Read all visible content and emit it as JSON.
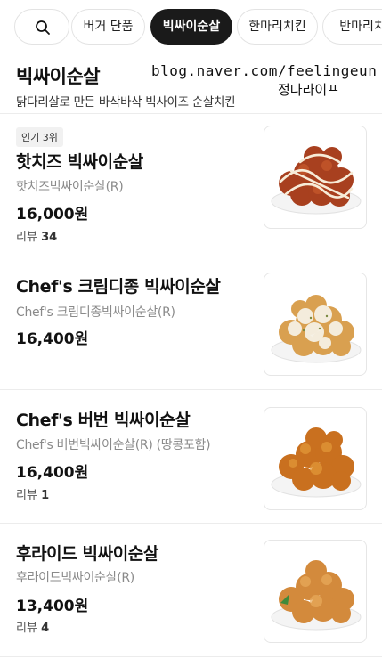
{
  "tabs": {
    "search_icon": "search-icon",
    "items": [
      {
        "label": "버거 단품",
        "active": false
      },
      {
        "label": "빅싸이순살",
        "active": true
      },
      {
        "label": "한마리치킨",
        "active": false
      },
      {
        "label": "반마리치",
        "active": false
      }
    ]
  },
  "category": {
    "title": "빅싸이순살",
    "description": "닭다리살로 만든 바삭바삭 빅사이즈 순살치킨"
  },
  "watermark": {
    "line1": "blog.naver.com/feelingeun",
    "line2": "정다라이프"
  },
  "menu": [
    {
      "badge": "인기 3위",
      "name": "핫치즈 빅싸이순살",
      "sub": "핫치즈빅싸이순살(R)",
      "price": "16,000원",
      "review_label": "리뷰",
      "review_count": "34",
      "image": "hot-cheese-chicken"
    },
    {
      "badge": "",
      "name": "Chef's 크림디종 빅싸이순살",
      "sub": "Chef's 크림디종빅싸이순살(R)",
      "price": "16,400원",
      "review_label": "",
      "review_count": "",
      "image": "cream-dijon-chicken"
    },
    {
      "badge": "",
      "name": "Chef's 버번 빅싸이순살",
      "sub": "Chef's 버번빅싸이순살(R) (땅콩포함)",
      "price": "16,400원",
      "review_label": "리뷰",
      "review_count": "1",
      "image": "bourbon-chicken"
    },
    {
      "badge": "",
      "name": "후라이드 빅싸이순살",
      "sub": "후라이드빅싸이순살(R)",
      "price": "13,400원",
      "review_label": "리뷰",
      "review_count": "4",
      "image": "fried-chicken"
    }
  ]
}
